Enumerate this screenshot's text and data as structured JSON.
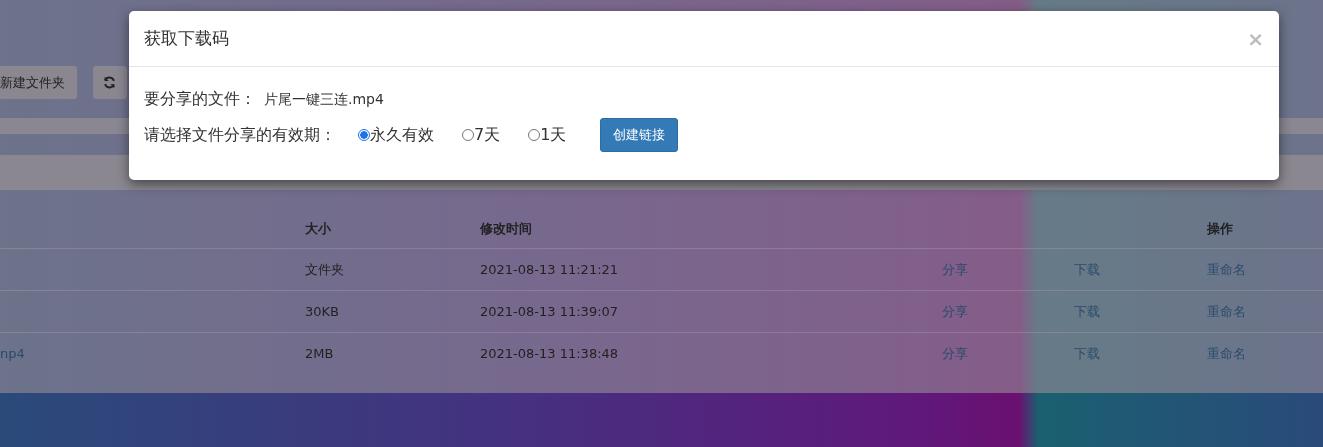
{
  "toolbar": {
    "buttons": [
      {
        "kind": "text",
        "label": "新建文件夹"
      },
      {
        "kind": "refresh"
      }
    ]
  },
  "table": {
    "columns": [
      "大小",
      "修改时间",
      "操作"
    ],
    "rows": [
      {
        "size": "文件夹",
        "modified": "2021-08-13 11:21:21",
        "share": "分享",
        "download": "下载",
        "rename": "重命名"
      },
      {
        "size": "30KB",
        "modified": "2021-08-13 11:39:07",
        "share": "分享",
        "download": "下载",
        "rename": "重命名"
      },
      {
        "name": "np4",
        "size": "2MB",
        "modified": "2021-08-13 11:38:48",
        "share": "分享",
        "download": "下载",
        "rename": "重命名"
      }
    ]
  },
  "dialog": {
    "title": "获取下载码",
    "close": "×",
    "file_label": "要分享的文件：",
    "file_name": "片尾一键三连.mp4",
    "period_label": "请选择文件分享的有效期：",
    "options": [
      {
        "label": "永久有效",
        "selected": true
      },
      {
        "label": "7天",
        "selected": false
      },
      {
        "label": "1天",
        "selected": false
      }
    ],
    "button": "创建链接"
  }
}
